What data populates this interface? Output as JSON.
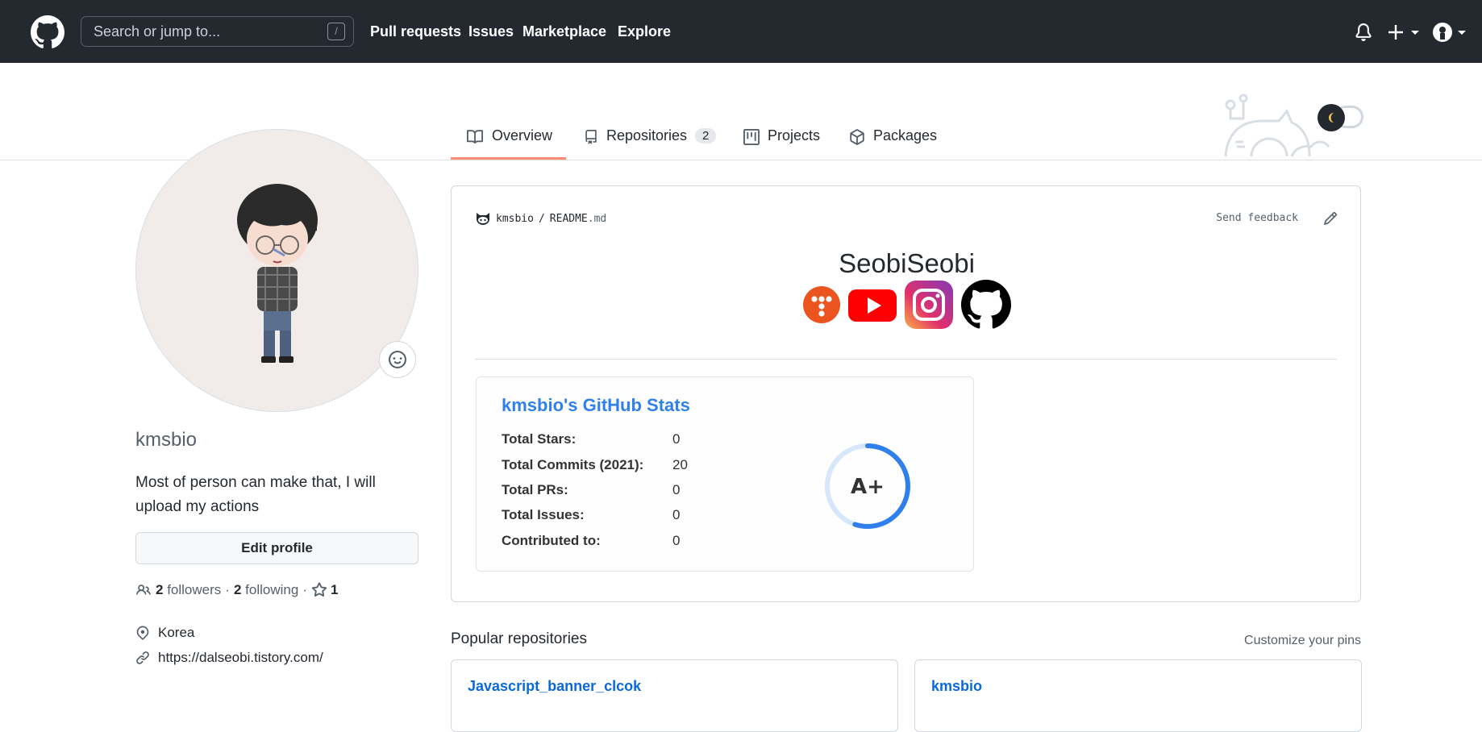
{
  "header": {
    "search_placeholder": "Search or jump to...",
    "search_shortcut": "/",
    "nav": [
      "Pull requests",
      "Issues",
      "Marketplace",
      "Explore"
    ]
  },
  "tabs": [
    {
      "label": "Overview",
      "active": true
    },
    {
      "label": "Repositories",
      "count": "2"
    },
    {
      "label": "Projects"
    },
    {
      "label": "Packages"
    }
  ],
  "profile": {
    "username": "kmsbio",
    "bio": "Most of person can make that, I will upload my actions",
    "edit_label": "Edit profile",
    "followers_count": "2",
    "followers_label": "followers",
    "following_count": "2",
    "following_label": "following",
    "stars_count": "1",
    "sep": "·",
    "location": "Korea",
    "website": "https://dalseobi.tistory.com/"
  },
  "readme": {
    "owner": "kmsbio",
    "sep": "/",
    "file": "README",
    "ext": ".md",
    "feedback": "Send feedback",
    "heading": "SeobiSeobi"
  },
  "stats": {
    "title": "kmsbio's GitHub Stats",
    "rows": [
      {
        "label": "Total Stars:",
        "value": "0"
      },
      {
        "label": "Total Commits (2021):",
        "value": "20"
      },
      {
        "label": "Total PRs:",
        "value": "0"
      },
      {
        "label": "Total Issues:",
        "value": "0"
      },
      {
        "label": "Contributed to:",
        "value": "0"
      }
    ],
    "rank": "A+",
    "rank_progress": 0.55,
    "accent": "#2f80ed"
  },
  "popular": {
    "title": "Popular repositories",
    "customize": "Customize your pins",
    "pins": [
      "Javascript_banner_clcok",
      "kmsbio"
    ]
  }
}
